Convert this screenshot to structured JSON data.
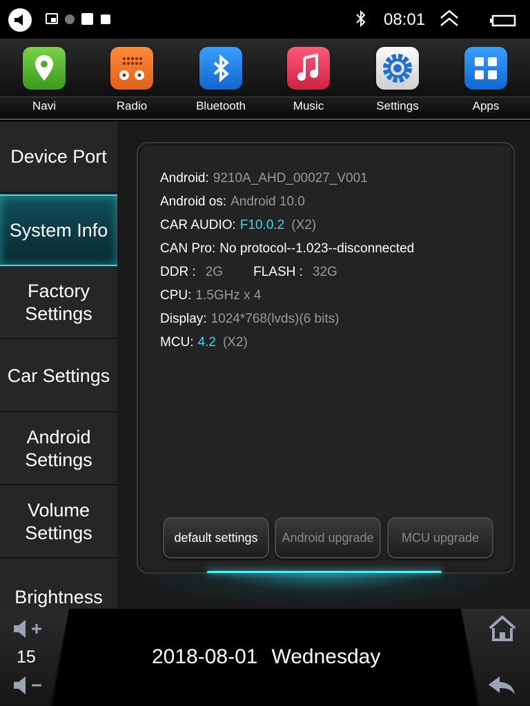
{
  "status_bar": {
    "time": "08:01",
    "icons": [
      "back-icon",
      "screen-icon",
      "dot-icon",
      "square-icon",
      "square-icon",
      "bluetooth-icon",
      "expand-up-icon",
      "battery-icon"
    ]
  },
  "apps": [
    {
      "label": "Navi",
      "icon": "map-pin-icon",
      "color": "#4cae2a"
    },
    {
      "label": "Radio",
      "icon": "radio-icon",
      "color": "#f07424"
    },
    {
      "label": "Bluetooth",
      "icon": "bluetooth-icon",
      "color": "#1e86e6"
    },
    {
      "label": "Music",
      "icon": "music-note-icon",
      "color": "#e43a5a"
    },
    {
      "label": "Settings",
      "icon": "gear-icon",
      "color": "#e8e8e8"
    },
    {
      "label": "Apps",
      "icon": "grid-icon",
      "color": "#1e80e4"
    }
  ],
  "sidebar": {
    "items": [
      {
        "label": "Device Port"
      },
      {
        "label": "System Info",
        "active": true
      },
      {
        "label": "Factory Settings"
      },
      {
        "label": "Car Settings"
      },
      {
        "label": "Android Settings"
      },
      {
        "label": "Volume Settings"
      },
      {
        "label": "Brightness"
      }
    ]
  },
  "info": {
    "android_label": "Android:",
    "android_value": "9210A_AHD_00027_V001",
    "android_os_label": "Android os:",
    "android_os_value": "Android 10.0",
    "car_audio_label": "CAR AUDIO:",
    "car_audio_value": "F10.0.2",
    "car_audio_suffix": "(X2)",
    "can_pro_label": "CAN Pro:",
    "can_pro_value": "No protocol--1.023--disconnected",
    "ddr_label": "DDR :",
    "ddr_value": "2G",
    "flash_label": "FLASH :",
    "flash_value": "32G",
    "cpu_label": "CPU:",
    "cpu_value": "1.5GHz x 4",
    "display_label": "Display:",
    "display_value": "1024*768(lvds)(6 bits)",
    "mcu_label": "MCU:",
    "mcu_value": "4.2",
    "mcu_suffix": "(X2)"
  },
  "buttons": {
    "default_settings": "default settings",
    "android_upgrade": "Android upgrade",
    "mcu_upgrade": "MCU upgrade"
  },
  "bottom": {
    "volume": "15",
    "date": "2018-08-01",
    "day": "Wednesday",
    "accent": "#3fd8e8"
  }
}
